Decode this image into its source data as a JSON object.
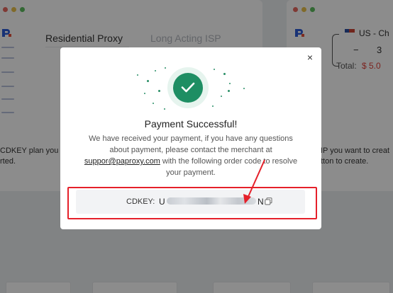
{
  "background": {
    "tabs": {
      "active": "Residential Proxy",
      "inactive": "Long Acting ISP"
    },
    "left_text": {
      "line1": "CDKEY plan you v",
      "line2": "rted."
    },
    "right_text": {
      "line1": "IP you want to creat",
      "line2": "tton to create."
    },
    "right_panel": {
      "country": "US - Ch",
      "minus": "−",
      "quantity": "3",
      "total_label": "Total:",
      "total_value": "$ 5.0"
    },
    "colors": {
      "dot_red": "#e8685f",
      "dot_yellow": "#e9c24c",
      "dot_green": "#5ebd5f"
    }
  },
  "modal": {
    "close_label": "×",
    "title": "Payment Successful!",
    "body_before": "We have received your payment, if you have any questions about payment, please contact the merchant at",
    "email": "suppor@paproxy.com",
    "body_after": "with the following order code to resolve your payment.",
    "code": {
      "label": "CDKEY:",
      "value_start": "U",
      "value_end": "N"
    },
    "colors": {
      "success": "#1e8e63",
      "annotation": "#e5202a"
    }
  }
}
